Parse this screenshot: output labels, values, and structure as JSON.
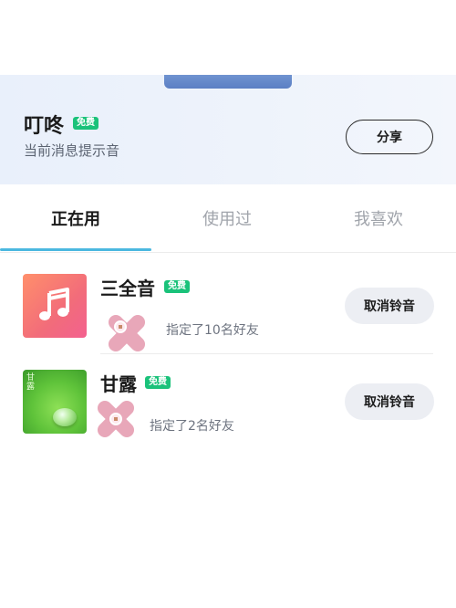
{
  "header": {
    "tone_name": "叮咚",
    "badge": "免费",
    "subtitle": "当前消息提示音",
    "share_label": "分享"
  },
  "tabs": [
    {
      "label": "正在用",
      "active": true
    },
    {
      "label": "使用过",
      "active": false
    },
    {
      "label": "我喜欢",
      "active": false
    }
  ],
  "items": [
    {
      "title": "三全音",
      "badge": "免费",
      "desc": "指定了10名好友",
      "action": "取消铃音",
      "cover_icon": "music-note-icon"
    },
    {
      "title": "甘露",
      "badge": "免费",
      "desc": "指定了2名好友",
      "action": "取消铃音",
      "cover_text": "甘露",
      "cover_icon": "water-drop-icon"
    }
  ],
  "colors": {
    "accent": "#4bb8e0",
    "badge": "#1ac27a",
    "header_bg": "#e9f0fb"
  }
}
